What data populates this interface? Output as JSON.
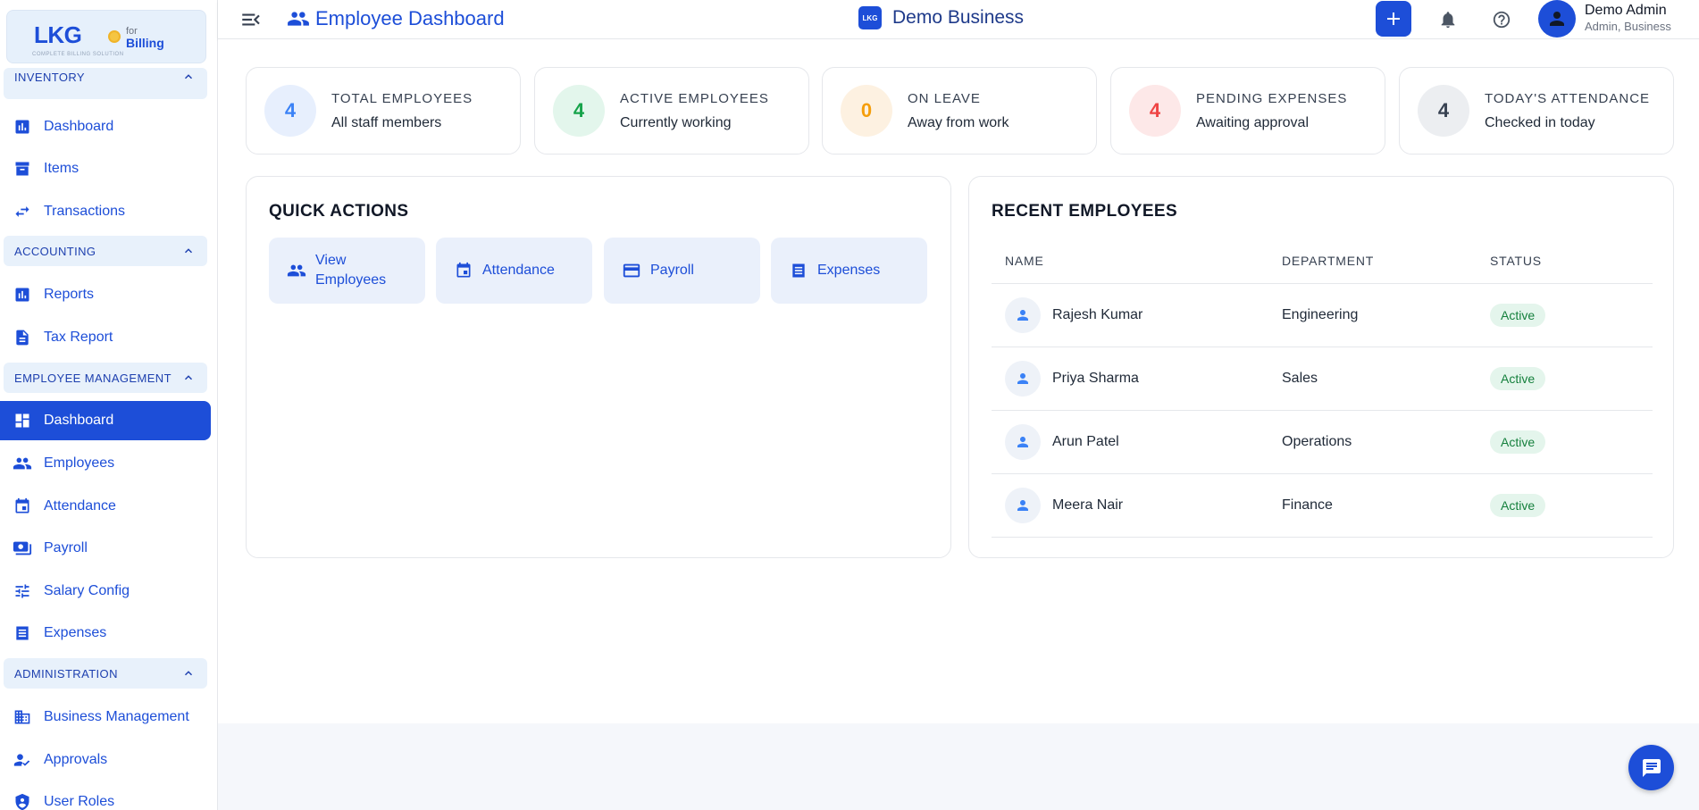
{
  "app": {
    "logo_main": "LKG",
    "logo_for": "for",
    "logo_billing": "Billing",
    "logo_tagline": "COMPLETE BILLING SOLUTION",
    "title": "Employee Dashboard",
    "business_logo": "LKG",
    "business_name": "Demo Business"
  },
  "user": {
    "name": "Demo Admin",
    "role": "Admin, Business"
  },
  "sidebar": {
    "sections": [
      {
        "label": "INVENTORY",
        "items": [
          {
            "label": "Dashboard",
            "icon": "bar-chart-icon"
          },
          {
            "label": "Items",
            "icon": "archive-box-icon"
          },
          {
            "label": "Transactions",
            "icon": "swap-arrows-icon"
          }
        ]
      },
      {
        "label": "ACCOUNTING",
        "items": [
          {
            "label": "Reports",
            "icon": "bar-chart-icon"
          },
          {
            "label": "Tax Report",
            "icon": "document-icon"
          }
        ]
      },
      {
        "label": "EMPLOYEE MANAGEMENT",
        "items": [
          {
            "label": "Dashboard",
            "icon": "dashboard-grid-icon",
            "active": true
          },
          {
            "label": "Employees",
            "icon": "people-icon"
          },
          {
            "label": "Attendance",
            "icon": "calendar-icon"
          },
          {
            "label": "Payroll",
            "icon": "money-icon"
          },
          {
            "label": "Salary Config",
            "icon": "sliders-icon"
          },
          {
            "label": "Expenses",
            "icon": "receipt-list-icon"
          }
        ]
      },
      {
        "label": "ADMINISTRATION",
        "items": [
          {
            "label": "Business Management",
            "icon": "building-icon"
          },
          {
            "label": "Approvals",
            "icon": "person-check-icon"
          },
          {
            "label": "User Roles",
            "icon": "shield-person-icon"
          }
        ]
      }
    ]
  },
  "stats": [
    {
      "value": "4",
      "title": "TOTAL EMPLOYEES",
      "subtitle": "All staff members",
      "color": "#3b82f6",
      "bg": "#e7effd"
    },
    {
      "value": "4",
      "title": "ACTIVE EMPLOYEES",
      "subtitle": "Currently working",
      "color": "#16a34a",
      "bg": "#e3f6ec"
    },
    {
      "value": "0",
      "title": "ON LEAVE",
      "subtitle": "Away from work",
      "color": "#f59e0b",
      "bg": "#fdf1e1"
    },
    {
      "value": "4",
      "title": "PENDING EXPENSES",
      "subtitle": "Awaiting approval",
      "color": "#ef4444",
      "bg": "#fde8e8"
    },
    {
      "value": "4",
      "title": "TODAY'S ATTENDANCE",
      "subtitle": "Checked in today",
      "color": "#374151",
      "bg": "#eceef1"
    }
  ],
  "quick_actions": {
    "title": "QUICK ACTIONS",
    "buttons": [
      {
        "label": "View Employees",
        "icon": "people-icon"
      },
      {
        "label": "Attendance",
        "icon": "calendar-icon"
      },
      {
        "label": "Payroll",
        "icon": "credit-card-icon"
      },
      {
        "label": "Expenses",
        "icon": "receipt-list-icon"
      }
    ]
  },
  "recent_employees": {
    "title": "RECENT EMPLOYEES",
    "columns": [
      "NAME",
      "DEPARTMENT",
      "STATUS"
    ],
    "rows": [
      {
        "name": "Rajesh Kumar",
        "department": "Engineering",
        "status": "Active"
      },
      {
        "name": "Priya Sharma",
        "department": "Sales",
        "status": "Active"
      },
      {
        "name": "Arun Patel",
        "department": "Operations",
        "status": "Active"
      },
      {
        "name": "Meera Nair",
        "department": "Finance",
        "status": "Active"
      }
    ]
  }
}
